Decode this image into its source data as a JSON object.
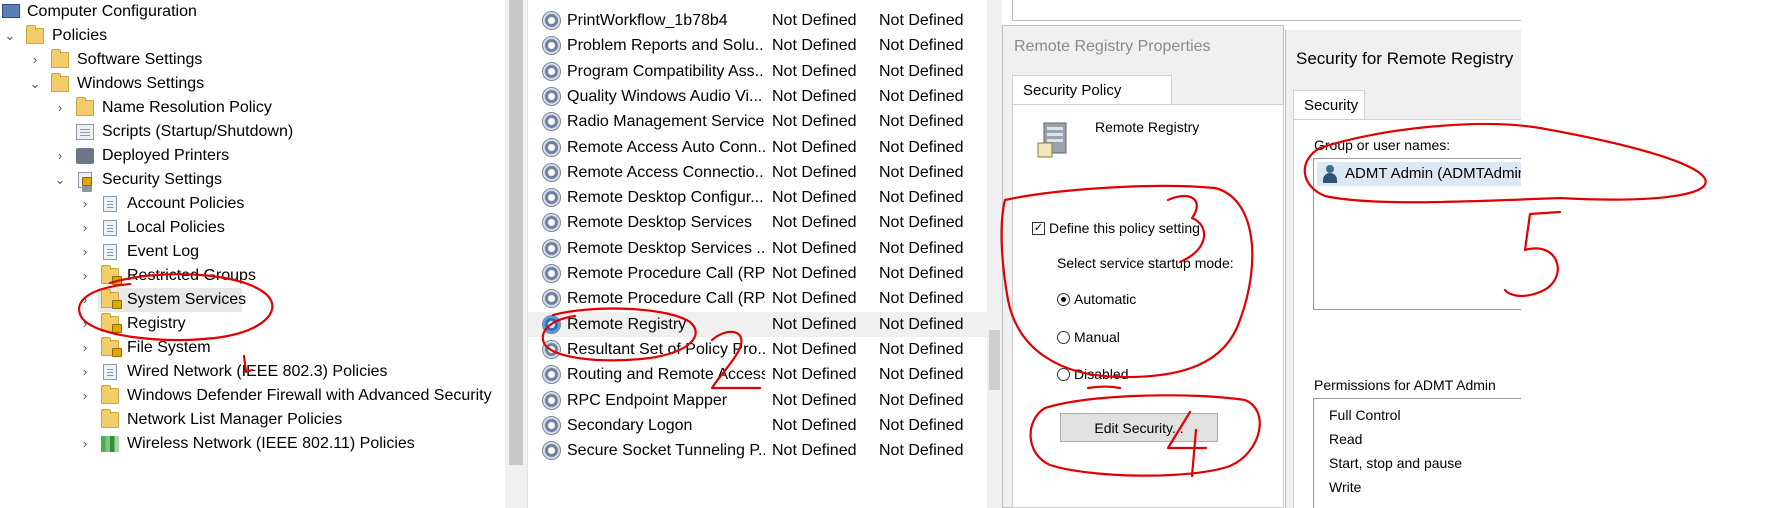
{
  "tree": {
    "root": "Computer Configuration",
    "policies": "Policies",
    "software_settings": "Software Settings",
    "windows_settings": "Windows Settings",
    "name_resolution": "Name Resolution Policy",
    "scripts": "Scripts (Startup/Shutdown)",
    "deployed_printers": "Deployed Printers",
    "security_settings": "Security Settings",
    "account_policies": "Account Policies",
    "local_policies": "Local Policies",
    "event_log": "Event Log",
    "restricted_groups": "Restricted Groups",
    "system_services": "System Services",
    "registry": "Registry",
    "file_system": "File System",
    "wired_network": "Wired Network (IEEE 802.3) Policies",
    "firewall": "Windows Defender Firewall with Advanced Security",
    "network_list": "Network List Manager Policies",
    "wireless": "Wireless Network (IEEE 802.11) Policies"
  },
  "services": [
    {
      "name": "PrintWorkflow_1b78b4",
      "startup": "Not Defined",
      "permission": "Not Defined"
    },
    {
      "name": "Problem Reports and Solu...",
      "startup": "Not Defined",
      "permission": "Not Defined"
    },
    {
      "name": "Program Compatibility Ass...",
      "startup": "Not Defined",
      "permission": "Not Defined"
    },
    {
      "name": "Quality Windows Audio Vi...",
      "startup": "Not Defined",
      "permission": "Not Defined"
    },
    {
      "name": "Radio Management Service",
      "startup": "Not Defined",
      "permission": "Not Defined"
    },
    {
      "name": "Remote Access Auto Conn...",
      "startup": "Not Defined",
      "permission": "Not Defined"
    },
    {
      "name": "Remote Access Connectio...",
      "startup": "Not Defined",
      "permission": "Not Defined"
    },
    {
      "name": "Remote Desktop Configur...",
      "startup": "Not Defined",
      "permission": "Not Defined"
    },
    {
      "name": "Remote Desktop Services",
      "startup": "Not Defined",
      "permission": "Not Defined"
    },
    {
      "name": "Remote Desktop Services ...",
      "startup": "Not Defined",
      "permission": "Not Defined"
    },
    {
      "name": "Remote Procedure Call (RPC)",
      "startup": "Not Defined",
      "permission": "Not Defined"
    },
    {
      "name": "Remote Procedure Call (RP...",
      "startup": "Not Defined",
      "permission": "Not Defined"
    },
    {
      "name": "Remote Registry",
      "startup": "Not Defined",
      "permission": "Not Defined"
    },
    {
      "name": "Resultant Set of Policy Pro...",
      "startup": "Not Defined",
      "permission": "Not Defined"
    },
    {
      "name": "Routing and Remote Access",
      "startup": "Not Defined",
      "permission": "Not Defined"
    },
    {
      "name": "RPC Endpoint Mapper",
      "startup": "Not Defined",
      "permission": "Not Defined"
    },
    {
      "name": "Secondary Logon",
      "startup": "Not Defined",
      "permission": "Not Defined"
    },
    {
      "name": "Secure Socket Tunneling P...",
      "startup": "Not Defined",
      "permission": "Not Defined"
    }
  ],
  "props_dialog": {
    "title": "Remote Registry Properties",
    "tab": "Security Policy Setting",
    "service_name": "Remote Registry",
    "define_label": "Define this policy setting",
    "mode_label": "Select service startup mode:",
    "automatic": "Automatic",
    "manual": "Manual",
    "disabled": "Disabled",
    "edit_security": "Edit Security..."
  },
  "security_dialog": {
    "title": "Security for Remote Registry",
    "tab": "Security",
    "group_label": "Group or user names:",
    "user": "ADMT Admin (ADMTAdmin",
    "permissions_label": "Permissions for ADMT Admin",
    "permissions": [
      "Full Control",
      "Read",
      "Start, stop and pause",
      "Write"
    ]
  },
  "annotations": [
    "1",
    "2",
    "3",
    "4",
    "5"
  ],
  "colors": {
    "annotation": "#e00000",
    "folder": "#f3cd6a",
    "selection": "#e8e8e8"
  }
}
